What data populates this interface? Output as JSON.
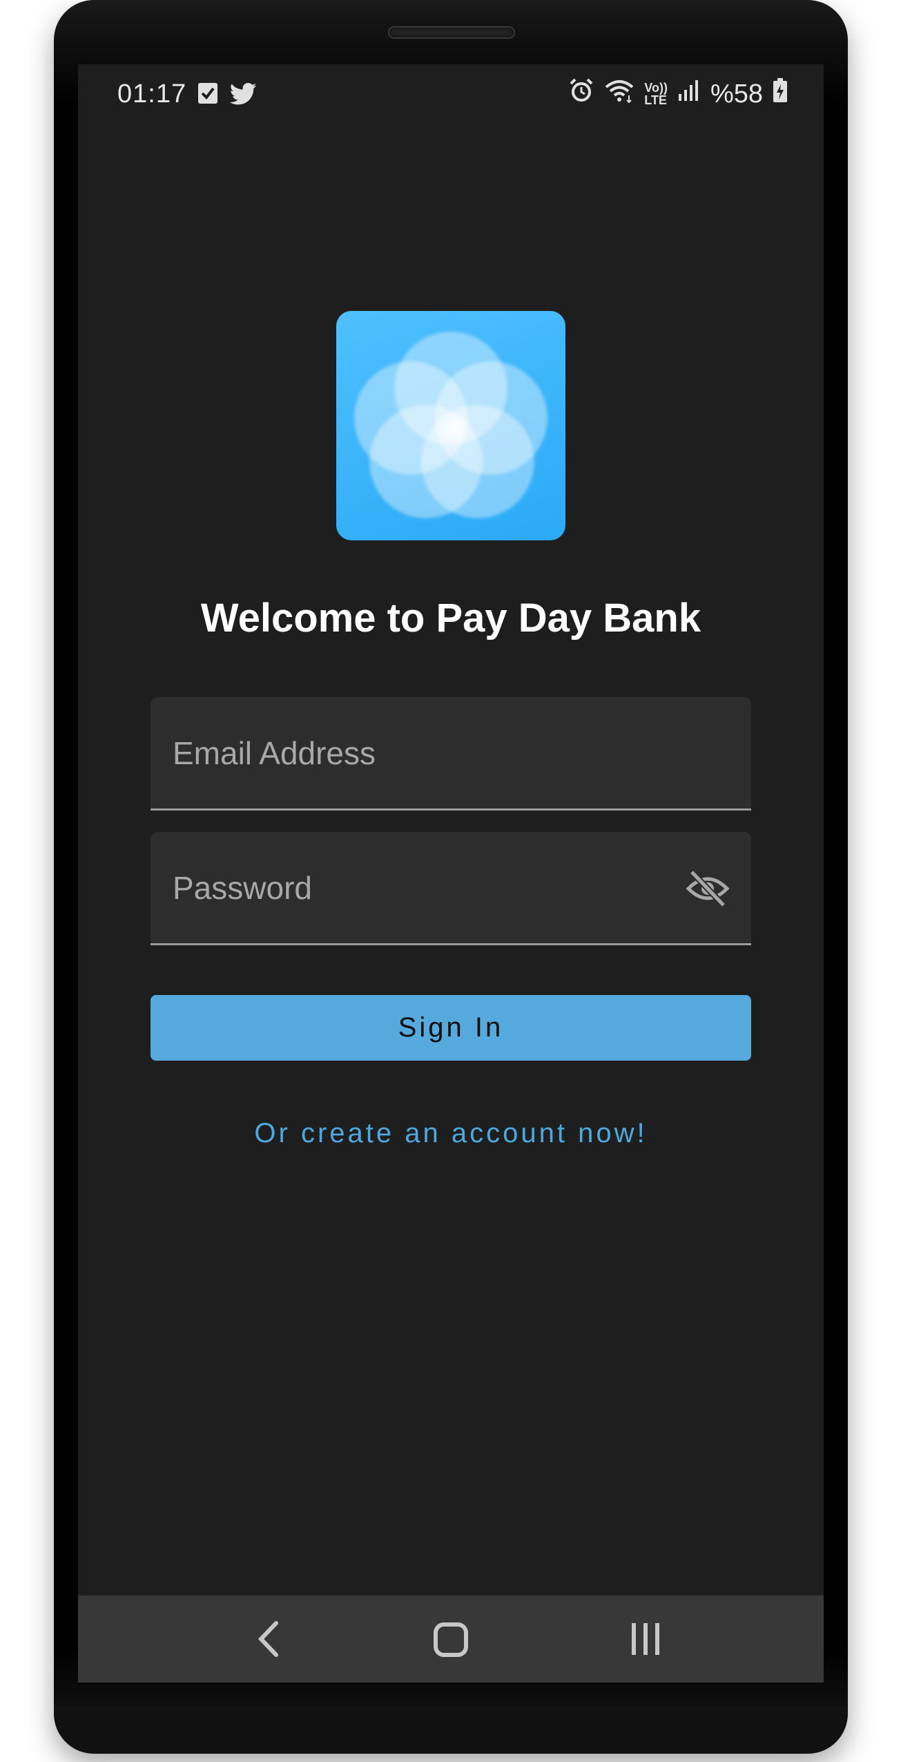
{
  "status_bar": {
    "time": "01:17",
    "left_icons": [
      "task-check-icon",
      "twitter-icon"
    ],
    "right_icons": [
      "alarm-icon",
      "wifi-icon",
      "volte-icon",
      "signal-icon",
      "battery-charging-icon"
    ],
    "volte_top": "Vo))",
    "volte_bottom": "LTE",
    "battery": "%58"
  },
  "app": {
    "logo_icon": "flower-logo-icon",
    "brand_color": "#2aa9f5",
    "welcome_title": "Welcome to Pay Day Bank"
  },
  "form": {
    "email_placeholder": "Email Address",
    "email_value": "",
    "password_placeholder": "Password",
    "password_value": "",
    "visibility_icon": "eye-off-icon",
    "sign_in_label": "Sign In",
    "sign_in_color": "#56a9dc",
    "create_account_label": "Or create an account now!",
    "link_color": "#4ea7df"
  },
  "nav_bar": {
    "buttons": [
      "back-icon",
      "home-icon",
      "recents-icon"
    ]
  }
}
